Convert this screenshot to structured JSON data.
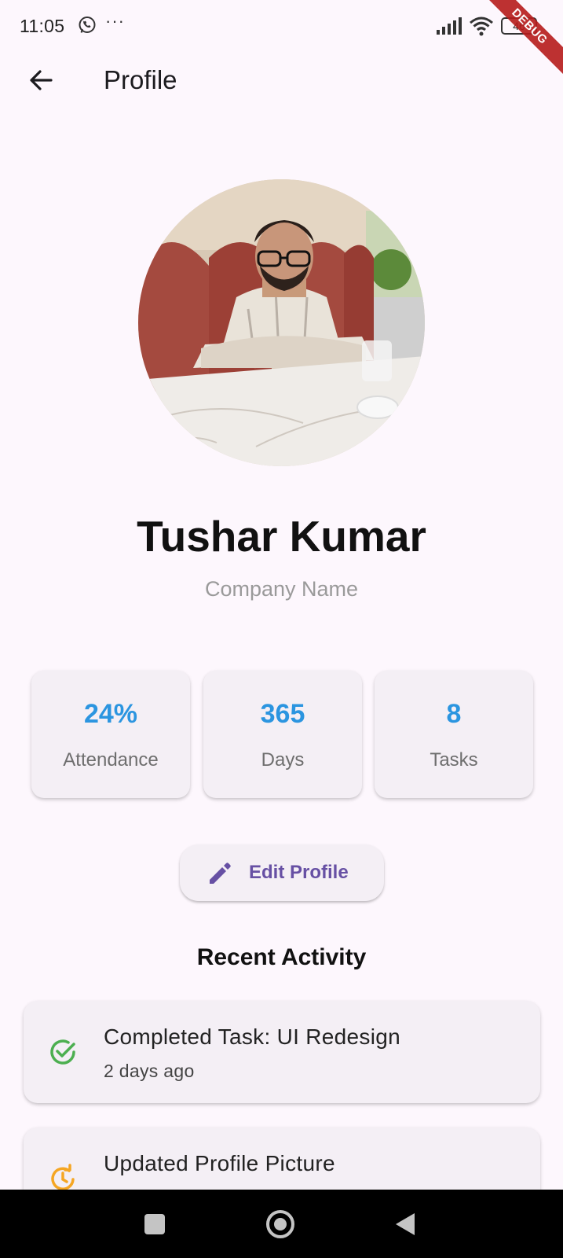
{
  "status_bar": {
    "time": "11:05",
    "more_indicator": "···",
    "battery_level": "46",
    "debug_label": "DEBUG"
  },
  "app_bar": {
    "title": "Profile"
  },
  "profile": {
    "name": "Tushar Kumar",
    "company": "Company Name"
  },
  "stats": [
    {
      "value": "24%",
      "label": "Attendance"
    },
    {
      "value": "365",
      "label": "Days"
    },
    {
      "value": "8",
      "label": "Tasks"
    }
  ],
  "edit_button": {
    "label": "Edit Profile"
  },
  "recent_activity": {
    "title": "Recent Activity",
    "items": [
      {
        "title": "Completed Task: UI Redesign",
        "time": "2 days ago",
        "icon": "check-circle-icon",
        "color": "#4caf50"
      },
      {
        "title": "Updated Profile Picture",
        "time": "",
        "icon": "clock-update-icon",
        "color": "#f5a623"
      }
    ]
  },
  "colors": {
    "background": "#fdf7fd",
    "card": "#f4eff5",
    "stat_value": "#2b95e0",
    "primary": "#6750a4"
  }
}
